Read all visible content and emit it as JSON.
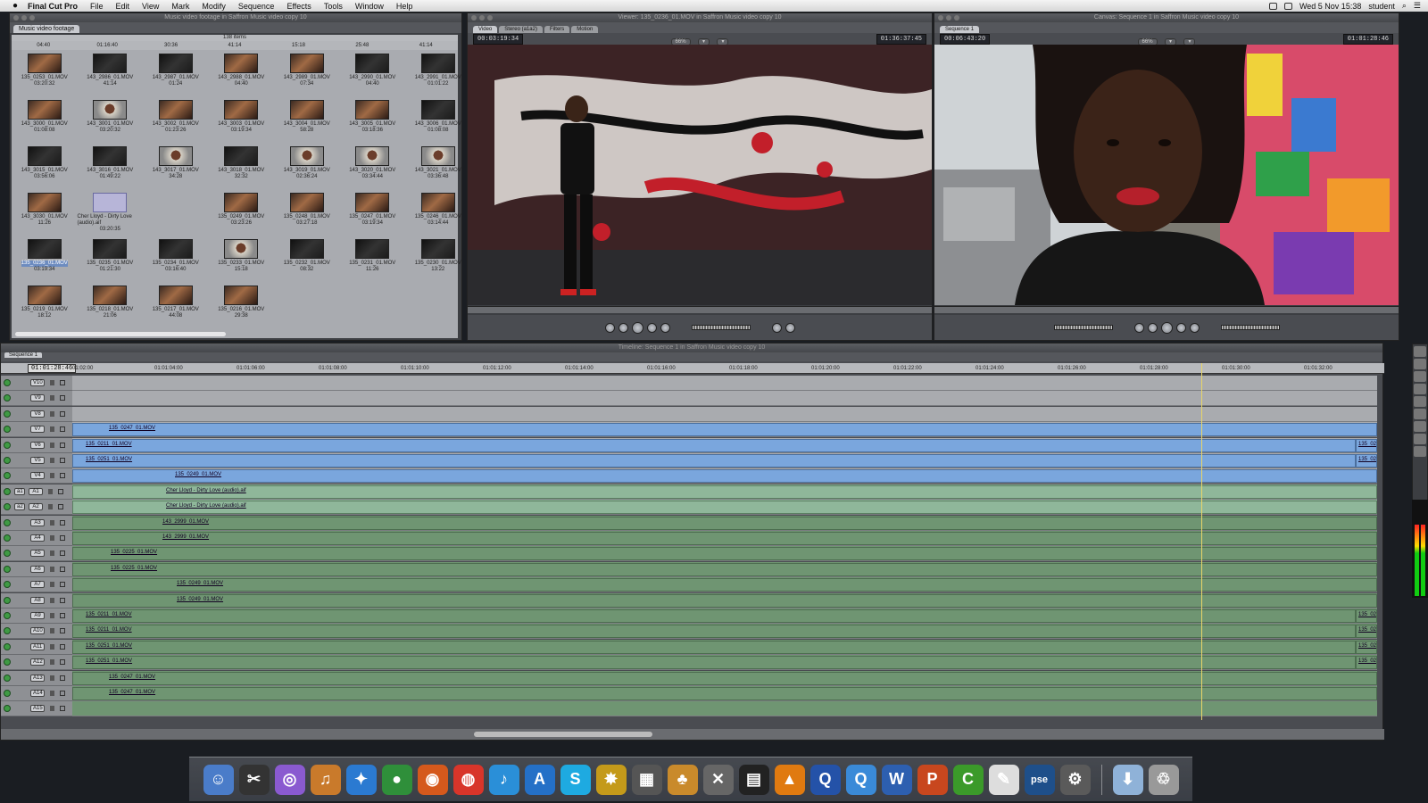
{
  "menubar": {
    "app": "Final Cut Pro",
    "items": [
      "File",
      "Edit",
      "View",
      "Mark",
      "Modify",
      "Sequence",
      "Effects",
      "Tools",
      "Window",
      "Help"
    ],
    "clock": "Wed 5 Nov  15:38",
    "user": "student"
  },
  "browser": {
    "title": "Music video footage in Saffron Music video copy 10",
    "tab": "Music video footage",
    "count": "138 items",
    "durations": [
      "04:40",
      "01:16:40",
      "30:36",
      "41:14",
      "15:18",
      "25:48",
      "41:14"
    ],
    "clips": [
      {
        "name": "135_0253_01.MOV",
        "dur": "03:20:32",
        "kind": "warm"
      },
      {
        "name": "143_2986_01.MOV",
        "dur": "41:14",
        "kind": "dark"
      },
      {
        "name": "143_2987_01.MOV",
        "dur": "01:24",
        "kind": "dark"
      },
      {
        "name": "143_2988_01.MOV",
        "dur": "04:40",
        "kind": "warm"
      },
      {
        "name": "143_2989_01.MOV",
        "dur": "07:34",
        "kind": "warm"
      },
      {
        "name": "143_2990_01.MOV",
        "dur": "04:40",
        "kind": "dark"
      },
      {
        "name": "143_2991_01.MOV",
        "dur": "01:01:22",
        "kind": "dark"
      },
      {
        "name": "143_3000_01.MOV",
        "dur": "01:08:08",
        "kind": "warm"
      },
      {
        "name": "143_3001_01.MOV",
        "dur": "03:20:32",
        "kind": "face"
      },
      {
        "name": "143_3002_01.MOV",
        "dur": "01:23:26",
        "kind": "warm"
      },
      {
        "name": "143_3003_01.MOV",
        "dur": "03:19:34",
        "kind": "warm"
      },
      {
        "name": "143_3004_01.MOV",
        "dur": "58:28",
        "kind": "warm"
      },
      {
        "name": "143_3005_01.MOV",
        "dur": "03:18:36",
        "kind": "warm"
      },
      {
        "name": "143_3006_01.MOV",
        "dur": "01:08:08",
        "kind": "dark"
      },
      {
        "name": "143_3015_01.MOV",
        "dur": "03:56:06",
        "kind": "dark"
      },
      {
        "name": "143_3016_01.MOV",
        "dur": "01:49:22",
        "kind": "dark"
      },
      {
        "name": "143_3017_01.MOV",
        "dur": "34:28",
        "kind": "face"
      },
      {
        "name": "143_3018_01.MOV",
        "dur": "32:32",
        "kind": "dark"
      },
      {
        "name": "143_3019_01.MOV",
        "dur": "02:36:24",
        "kind": "face"
      },
      {
        "name": "143_3020_01.MOV",
        "dur": "03:34:44",
        "kind": "face"
      },
      {
        "name": "143_3021_01.MOV",
        "dur": "03:36:48",
        "kind": "face"
      },
      {
        "name": "143_3030_01.MOV",
        "dur": "11:26",
        "kind": "warm"
      },
      {
        "name": "Cher Lloyd - Dirty Love (audio).aif",
        "dur": "03:20:35",
        "kind": "audio"
      },
      {
        "name": "",
        "dur": "",
        "kind": "blank"
      },
      {
        "name": "135_0249_01.MOV",
        "dur": "03:23:26",
        "kind": "warm"
      },
      {
        "name": "135_0248_01.MOV",
        "dur": "03:27:18",
        "kind": "warm"
      },
      {
        "name": "135_0247_01.MOV",
        "dur": "03:19:34",
        "kind": "warm"
      },
      {
        "name": "135_0246_01.MOV",
        "dur": "03:14:44",
        "kind": "warm"
      },
      {
        "name": "135_0236_01.MOV",
        "dur": "03:19:34",
        "kind": "dark",
        "selected": true
      },
      {
        "name": "135_0235_01.MOV",
        "dur": "01:21:30",
        "kind": "dark"
      },
      {
        "name": "135_0234_01.MOV",
        "dur": "03:16:40",
        "kind": "dark"
      },
      {
        "name": "135_0233_01.MOV",
        "dur": "15:18",
        "kind": "face"
      },
      {
        "name": "135_0232_01.MOV",
        "dur": "08:32",
        "kind": "dark"
      },
      {
        "name": "135_0231_01.MOV",
        "dur": "11:26",
        "kind": "dark"
      },
      {
        "name": "135_0230_01.MOV",
        "dur": "13:22",
        "kind": "dark"
      },
      {
        "name": "135_0219_01.MOV",
        "dur": "18:12",
        "kind": "warm"
      },
      {
        "name": "135_0218_01.MOV",
        "dur": "21:06",
        "kind": "warm"
      },
      {
        "name": "135_0217_01.MOV",
        "dur": "44:08",
        "kind": "warm"
      },
      {
        "name": "135_0216_01.MOV",
        "dur": "29:38",
        "kind": "warm"
      }
    ]
  },
  "viewer": {
    "title": "Viewer: 135_0236_01.MOV in Saffron Music video copy 10",
    "tabs": [
      "Video",
      "Stereo (a1a2)",
      "Filters",
      "Motion"
    ],
    "tc_left": "00:03:19:34",
    "tc_right": "01:36:37:45",
    "zoom": "66%"
  },
  "canvas": {
    "title": "Canvas: Sequence 1 in Saffron Music video copy 10",
    "tab": "Sequence 1",
    "tc_left": "00:06:43:20",
    "tc_right": "01:01:28:46",
    "zoom": "66%"
  },
  "timeline": {
    "title": "Timeline: Sequence 1 in Saffron Music video copy 10",
    "tab": "Sequence 1",
    "playhead_tc": "01:01:28:46",
    "ruler": [
      "01:02:00",
      "01:01:04:00",
      "01:01:06:00",
      "01:01:08:00",
      "01:01:10:00",
      "01:01:12:00",
      "01:01:14:00",
      "01:01:16:00",
      "01:01:18:00",
      "01:01:20:00",
      "01:01:22:00",
      "01:01:24:00",
      "01:01:26:00",
      "01:01:28:00",
      "01:01:30:00",
      "01:01:32:00"
    ],
    "tracks": [
      {
        "label": "V10",
        "type": "v",
        "clips": []
      },
      {
        "label": "V9",
        "type": "v",
        "clips": []
      },
      {
        "label": "V8",
        "type": "v",
        "clips": []
      },
      {
        "label": "V7",
        "type": "v",
        "clips": [
          {
            "name": "135_0247_01.MOV"
          }
        ]
      },
      {
        "label": "V6",
        "type": "v",
        "clips": [
          {
            "name": "135_0211_01.MOV"
          },
          {
            "name": "135_02"
          }
        ]
      },
      {
        "label": "V5",
        "type": "v",
        "clips": [
          {
            "name": "135_0251_01.MOV"
          },
          {
            "name": "135_02"
          }
        ]
      },
      {
        "label": "V4",
        "type": "v",
        "clips": [
          {
            "name": "135_0249_01.MOV"
          }
        ]
      },
      {
        "label": "A1",
        "src": "a1",
        "type": "a",
        "clips": [
          {
            "name": "Cher Lloyd - Dirty Love (audio).aif"
          }
        ]
      },
      {
        "label": "A2",
        "src": "a2",
        "type": "a",
        "clips": [
          {
            "name": "Cher Lloyd - Dirty Love (audio).aif"
          }
        ]
      },
      {
        "label": "A3",
        "type": "ad",
        "clips": [
          {
            "name": "143_2999_01.MOV"
          }
        ]
      },
      {
        "label": "A4",
        "type": "ad",
        "clips": [
          {
            "name": "143_2999_01.MOV"
          }
        ]
      },
      {
        "label": "A5",
        "type": "ad",
        "clips": [
          {
            "name": "135_0225_01.MOV"
          }
        ]
      },
      {
        "label": "A6",
        "type": "ad",
        "clips": [
          {
            "name": "135_0225_01.MOV"
          }
        ]
      },
      {
        "label": "A7",
        "type": "ad",
        "clips": [
          {
            "name": "135_0249_01.MOV"
          }
        ]
      },
      {
        "label": "A8",
        "type": "ad",
        "clips": [
          {
            "name": "135_0249_01.MOV"
          }
        ]
      },
      {
        "label": "A9",
        "type": "ad",
        "clips": [
          {
            "name": "135_0211_01.MOV"
          },
          {
            "name": "135_02"
          }
        ]
      },
      {
        "label": "A10",
        "type": "ad",
        "clips": [
          {
            "name": "135_0211_01.MOV"
          },
          {
            "name": "135_02"
          }
        ]
      },
      {
        "label": "A11",
        "type": "ad",
        "clips": [
          {
            "name": "135_0251_01.MOV"
          },
          {
            "name": "135_02"
          }
        ]
      },
      {
        "label": "A12",
        "type": "ad",
        "clips": [
          {
            "name": "135_0251_01.MOV"
          },
          {
            "name": "135_02"
          }
        ]
      },
      {
        "label": "A13",
        "type": "ad",
        "clips": [
          {
            "name": "135_0247_01.MOV"
          }
        ]
      },
      {
        "label": "A14",
        "type": "ad",
        "clips": [
          {
            "name": "135_0247_01.MOV"
          }
        ]
      },
      {
        "label": "A15",
        "type": "ad",
        "clips": []
      }
    ]
  },
  "dock": {
    "apps": [
      {
        "icon": "finder-icon",
        "glyph": "☺",
        "color": "#4a7cc9"
      },
      {
        "icon": "final-cut-clapper-icon",
        "glyph": "✂",
        "color": "#333"
      },
      {
        "icon": "motion-icon",
        "glyph": "◎",
        "color": "#8a5ad0"
      },
      {
        "icon": "garageband-icon",
        "glyph": "♫",
        "color": "#c97a2b"
      },
      {
        "icon": "safari-icon",
        "glyph": "✦",
        "color": "#2b7ad1"
      },
      {
        "icon": "globe-icon",
        "glyph": "●",
        "color": "#2f8f3a"
      },
      {
        "icon": "firefox-icon",
        "glyph": "◉",
        "color": "#d5591c"
      },
      {
        "icon": "chrome-icon",
        "glyph": "◍",
        "color": "#d8352a"
      },
      {
        "icon": "itunes-icon",
        "glyph": "♪",
        "color": "#2a8fd8"
      },
      {
        "icon": "app-store-icon",
        "glyph": "A",
        "color": "#2470c7"
      },
      {
        "icon": "skype-icon",
        "glyph": "S",
        "color": "#1eaae1"
      },
      {
        "icon": "flash-icon",
        "glyph": "✸",
        "color": "#c49a1a"
      },
      {
        "icon": "calculator-icon",
        "glyph": "▦",
        "color": "#555"
      },
      {
        "icon": "fruit-app-icon",
        "glyph": "♣",
        "color": "#c98a2b"
      },
      {
        "icon": "x11-icon",
        "glyph": "✕",
        "color": "#666"
      },
      {
        "icon": "clapperboard-icon",
        "glyph": "▤",
        "color": "#222"
      },
      {
        "icon": "vlc-icon",
        "glyph": "▲",
        "color": "#e07a10"
      },
      {
        "icon": "quicktime-icon",
        "glyph": "Q",
        "color": "#2452a8"
      },
      {
        "icon": "quicktime-x-icon",
        "glyph": "Q",
        "color": "#3a8ad8"
      },
      {
        "icon": "word-icon",
        "glyph": "W",
        "color": "#2d5fb0"
      },
      {
        "icon": "powerpoint-icon",
        "glyph": "P",
        "color": "#c8471e"
      },
      {
        "icon": "camtasia-icon",
        "glyph": "C",
        "color": "#3b9a2a"
      },
      {
        "icon": "textedit-icon",
        "glyph": "✎",
        "color": "#ddd"
      },
      {
        "icon": "photoshop-elements-icon",
        "glyph": "pse",
        "color": "#1e4f8a"
      },
      {
        "icon": "compressor-icon",
        "glyph": "⚙",
        "color": "#5a5a5a"
      },
      {
        "icon": "downloads-folder-icon",
        "glyph": "⬇",
        "color": "#8fb2d8"
      },
      {
        "icon": "trash-icon",
        "glyph": "♲",
        "color": "#999"
      }
    ]
  }
}
